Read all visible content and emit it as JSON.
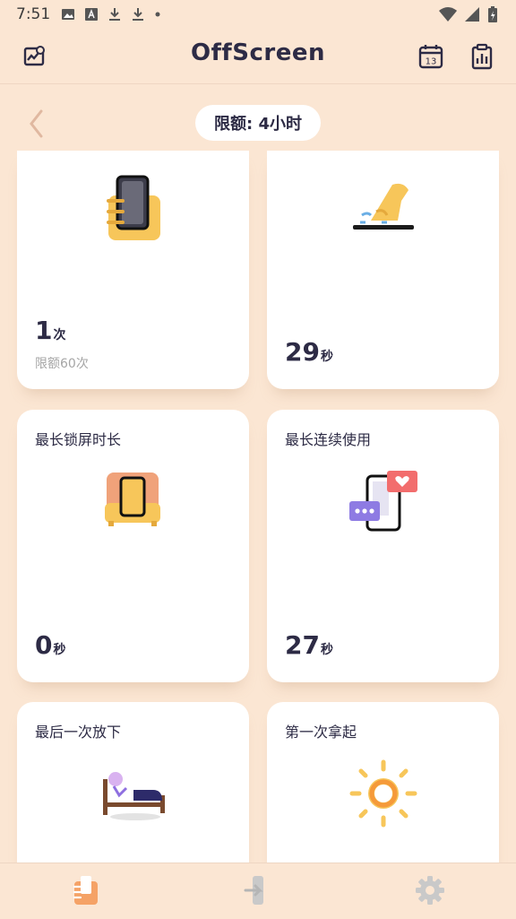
{
  "status_bar": {
    "time": "7:51"
  },
  "app": {
    "title": "OffScreen"
  },
  "limit": {
    "label": "限额: 4小时"
  },
  "cards": {
    "pickups": {
      "value": "1",
      "unit": "次",
      "sub": "限额60次"
    },
    "avg_session": {
      "value": "29",
      "unit": "秒"
    },
    "longest_lock": {
      "title": "最长锁屏时长",
      "value": "0",
      "unit": "秒"
    },
    "longest_use": {
      "title": "最长连续使用",
      "value": "27",
      "unit": "秒"
    },
    "last_putdown": {
      "title": "最后一次放下"
    },
    "first_pickup": {
      "title": "第一次拿起"
    }
  },
  "colors": {
    "background": "#FBE6D3",
    "accent": "#F5A266",
    "navy": "#2D2B45",
    "yellow": "#F7C65A"
  }
}
